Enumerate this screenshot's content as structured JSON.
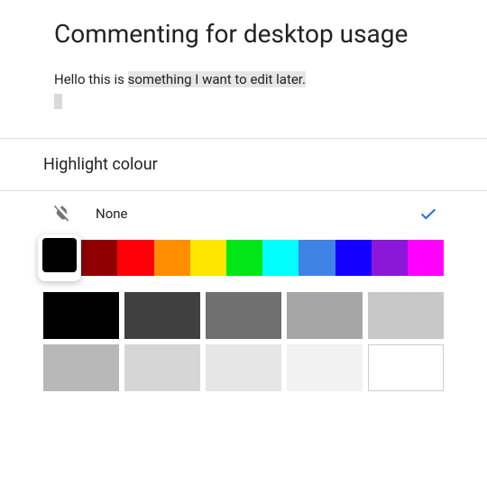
{
  "doc": {
    "title": "Commenting for desktop usage",
    "body_plain": "Hello this is ",
    "body_highlighted": "something I want to edit later."
  },
  "panel": {
    "title": "Highlight colour",
    "none_label": "None",
    "selected": "None",
    "strip_colors": [
      "#000000",
      "#8f0003",
      "#ff0008",
      "#ff8d00",
      "#ffe600",
      "#00e617",
      "#00ffff",
      "#3f84e5",
      "#1400ff",
      "#8c17d9",
      "#ff00ff"
    ],
    "selected_strip_index": 0,
    "gray_row1": [
      "#000000",
      "#404040",
      "#707070",
      "#a6a6a6",
      "#c8c8c8"
    ],
    "gray_row2": [
      "#b8b8b8",
      "#d6d6d6",
      "#e6e6e6",
      "#f2f2f2",
      "#ffffff"
    ]
  }
}
